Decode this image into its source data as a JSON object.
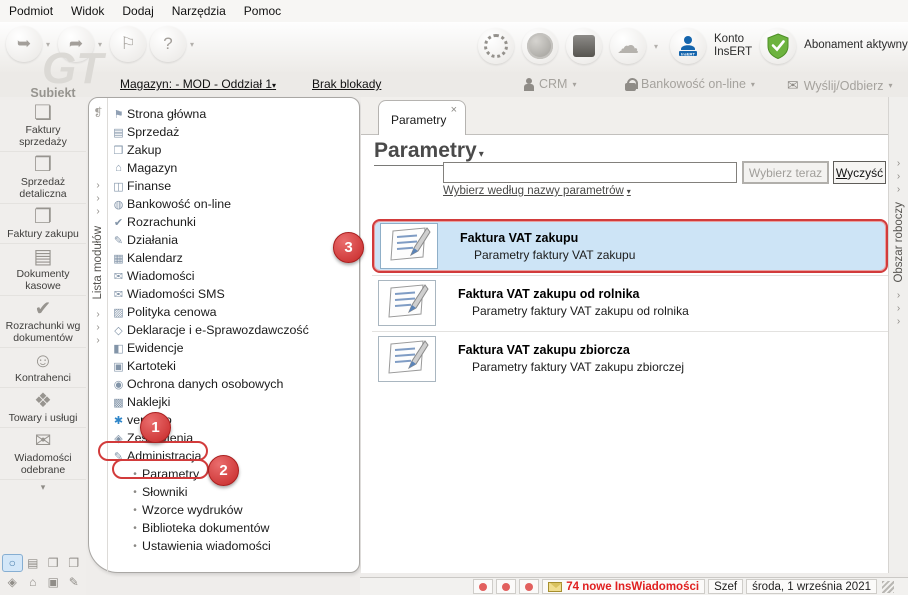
{
  "menu": {
    "items": [
      "Podmiot",
      "Widok",
      "Dodaj",
      "Narzędzia",
      "Pomoc"
    ]
  },
  "toolbar": {
    "konto_line1": "Konto",
    "konto_line2": "InsERT",
    "abonament_label": "Abonament aktywny"
  },
  "context_bar": {
    "magazyn_link": "Magazyn: - MOD - Oddział 1",
    "blokada_link": "Brak blokady",
    "crm_label": "CRM",
    "bankowosc_label": "Bankowość on-line",
    "wyslij_label": "Wyślij/Odbierz"
  },
  "branding": {
    "logo": "GT",
    "app_name": "Subiekt"
  },
  "module_strip_label": "Lista modułów",
  "workspace_strip_label": "Obszar roboczy",
  "module_sidebar": {
    "items": [
      {
        "label": "Faktury sprzedaży"
      },
      {
        "label": "Sprzedaż detaliczna"
      },
      {
        "label": "Faktury zakupu"
      },
      {
        "label": "Dokumenty kasowe"
      },
      {
        "label": "Rozrachunki wg dokumentów"
      },
      {
        "label": "Kontrahenci"
      },
      {
        "label": "Towary i usługi"
      },
      {
        "label": "Wiadomości odebrane"
      }
    ]
  },
  "tree": {
    "items": [
      {
        "label": "Strona główna"
      },
      {
        "label": "Sprzedaż"
      },
      {
        "label": "Zakup"
      },
      {
        "label": "Magazyn"
      },
      {
        "label": "Finanse"
      },
      {
        "label": "Bankowość on-line"
      },
      {
        "label": "Rozrachunki"
      },
      {
        "label": "Działania"
      },
      {
        "label": "Kalendarz"
      },
      {
        "label": "Wiadomości"
      },
      {
        "label": "Wiadomości SMS"
      },
      {
        "label": "Polityka cenowa"
      },
      {
        "label": "Deklaracje i e-Sprawozdawczość"
      },
      {
        "label": "Ewidencje"
      },
      {
        "label": "Kartoteki"
      },
      {
        "label": "Ochrona danych osobowych"
      },
      {
        "label": "Naklejki"
      },
      {
        "label": "vendero"
      },
      {
        "label": "Zestawienia"
      },
      {
        "label": "Administracja"
      }
    ],
    "admin_children": [
      {
        "label": "Parametry"
      },
      {
        "label": "Słowniki"
      },
      {
        "label": "Wzorce wydruków"
      },
      {
        "label": "Biblioteka dokumentów"
      },
      {
        "label": "Ustawienia wiadomości"
      }
    ]
  },
  "content": {
    "tab_label": "Parametry",
    "tab_close": "×",
    "heading": "Parametry",
    "search_value": "",
    "select_button": "Wybierz teraz",
    "clear_button": "Wyczyść",
    "filter_link": "Wybierz według nazwy parametrów",
    "items": [
      {
        "title": "Faktura VAT zakupu",
        "subtitle": "Parametry faktury VAT zakupu"
      },
      {
        "title": "Faktura VAT zakupu od rolnika",
        "subtitle": "Parametry faktury VAT zakupu od rolnika"
      },
      {
        "title": "Faktura VAT zakupu zbiorcza",
        "subtitle": "Parametry faktury VAT zakupu zbiorczej"
      }
    ]
  },
  "annotations": {
    "step1": "1",
    "step2": "2",
    "step3": "3"
  },
  "status_bar": {
    "messages": "74 nowe InsWiadomości",
    "user": "Szef",
    "date": "środa, 1 września 2021"
  },
  "colors": {
    "annotation_red": "#d23b3b",
    "selection_blue": "#cde4f6",
    "alert_text_red": "#e02020",
    "abonament_green": "#6db33f",
    "insert_blue": "#1565ad"
  }
}
